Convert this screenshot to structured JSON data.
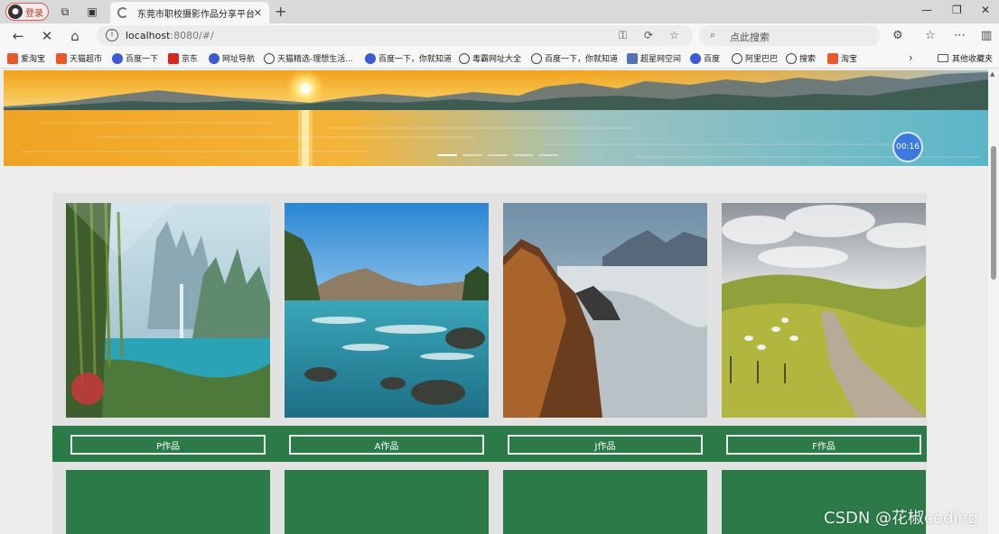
{
  "browser": {
    "profile_label": "登录",
    "tab_title": "东莞市职校摄影作品分享平台",
    "url_host": "localhost",
    "url_rest": ":8080/#/",
    "search_placeholder": "点此搜索"
  },
  "bookmarks": [
    {
      "label": "爱淘宝",
      "icon": "tmall"
    },
    {
      "label": "天猫超市",
      "icon": "tmall"
    },
    {
      "label": "百度一下",
      "icon": "baidu"
    },
    {
      "label": "京东",
      "icon": "jd"
    },
    {
      "label": "网址导航",
      "icon": "baidu"
    },
    {
      "label": "天猫精选-理想生活...",
      "icon": "globe"
    },
    {
      "label": "百度一下，你就知道",
      "icon": "baidu"
    },
    {
      "label": "毒霸网址大全",
      "icon": "globe"
    },
    {
      "label": "百度一下，你就知道",
      "icon": "globe"
    },
    {
      "label": "超星网空间",
      "icon": "star"
    },
    {
      "label": "百度",
      "icon": "baidu"
    },
    {
      "label": "阿里巴巴",
      "icon": "globe"
    },
    {
      "label": "搜索",
      "icon": "globe"
    },
    {
      "label": "淘宝",
      "icon": "tmall"
    }
  ],
  "bookmarks_folder": "其他收藏夹",
  "banner": {
    "timer": "00:16",
    "dots": 5,
    "active_dot": 0
  },
  "gallery": {
    "works": [
      {
        "label": "P作品",
        "scene": "fantasy-waterfall"
      },
      {
        "label": "A作品",
        "scene": "mountain-river"
      },
      {
        "label": "J作品",
        "scene": "cliff-clouds"
      },
      {
        "label": "F作品",
        "scene": "country-road"
      }
    ]
  },
  "watermark": "CSDN @花椒coding",
  "colors": {
    "brand_green": "#2c7a48",
    "timer_blue": "#3b7be0"
  }
}
